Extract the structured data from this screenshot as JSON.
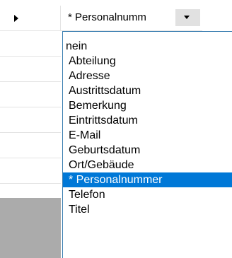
{
  "combo": {
    "value": "* Personalnumm"
  },
  "dropdown": {
    "items": [
      {
        "label": "nein"
      },
      {
        "label": "Abteilung"
      },
      {
        "label": "Adresse"
      },
      {
        "label": "Austrittsdatum"
      },
      {
        "label": "Bemerkung"
      },
      {
        "label": "Eintrittsdatum"
      },
      {
        "label": "E-Mail"
      },
      {
        "label": "Geburtsdatum"
      },
      {
        "label": "Ort/Gebäude"
      },
      {
        "label": "* Personalnummer"
      },
      {
        "label": "Telefon"
      },
      {
        "label": "Titel"
      }
    ],
    "selected": "* Personalnummer"
  },
  "colors": {
    "selection": "#0078d7",
    "dropdown_border": "#3c7fb1",
    "empty_area": "#ababab"
  },
  "icons": {
    "current_row": "current-row-arrow-icon",
    "combo_dropdown": "chevron-down-icon"
  }
}
